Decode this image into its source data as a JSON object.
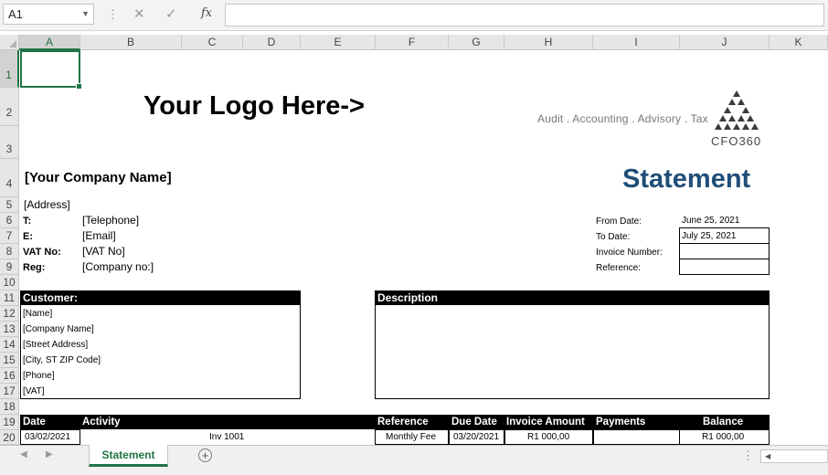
{
  "formula_bar": {
    "name_box": "A1",
    "fx": "fx",
    "cancel": "✕",
    "enter": "✓",
    "value": ""
  },
  "columns": [
    "A",
    "B",
    "C",
    "D",
    "E",
    "F",
    "G",
    "H",
    "I",
    "J",
    "K"
  ],
  "rows": [
    "1",
    "2",
    "3",
    "4",
    "5",
    "6",
    "7",
    "8",
    "9",
    "10",
    "11",
    "12",
    "13",
    "14",
    "15",
    "16",
    "17",
    "18",
    "19",
    "20"
  ],
  "header": {
    "logo_placeholder": "Your Logo Here->",
    "tagline": "Audit . Accounting . Advisory . Tax",
    "brand": "CFO360",
    "company_name": "[Your Company Name]",
    "title": "Statement",
    "title_color": "#1f4e79"
  },
  "company": {
    "address": "[Address]",
    "fields": [
      {
        "label": "T:",
        "value": "[Telephone]"
      },
      {
        "label": "E:",
        "value": "[Email]"
      },
      {
        "label": "VAT No:",
        "value": "[VAT No]"
      },
      {
        "label": "Reg:",
        "value": "[Company no:]"
      }
    ]
  },
  "statement_info": {
    "from_label": "From Date:",
    "from_value": "June 25, 2021",
    "to_label": "To Date:",
    "to_value": "July 25, 2021",
    "invoice_label": "Invoice Number:",
    "invoice_value": "",
    "reference_label": "Reference:",
    "reference_value": ""
  },
  "customer": {
    "heading": "Customer:",
    "lines": [
      "[Name]",
      "[Company Name]",
      "[Street Address]",
      "[City, ST  ZIP Code]",
      "[Phone]",
      "[VAT]"
    ]
  },
  "description": {
    "heading": "Description"
  },
  "table": {
    "headers": {
      "date": "Date",
      "activity": "Activity",
      "reference": "Reference",
      "due_date": "Due Date",
      "invoice_amount": "Invoice Amount",
      "payments": "Payments",
      "balance": "Balance"
    },
    "rows": [
      {
        "date": "03/02/2021",
        "activity": "Inv 1001",
        "reference": "Monthly Fee",
        "due_date": "03/20/2021",
        "invoice_amount": "R1 000,00",
        "payments": "",
        "balance": "R1 000,00"
      }
    ]
  },
  "sheet_tabs": {
    "active": "Statement",
    "add": "+"
  }
}
